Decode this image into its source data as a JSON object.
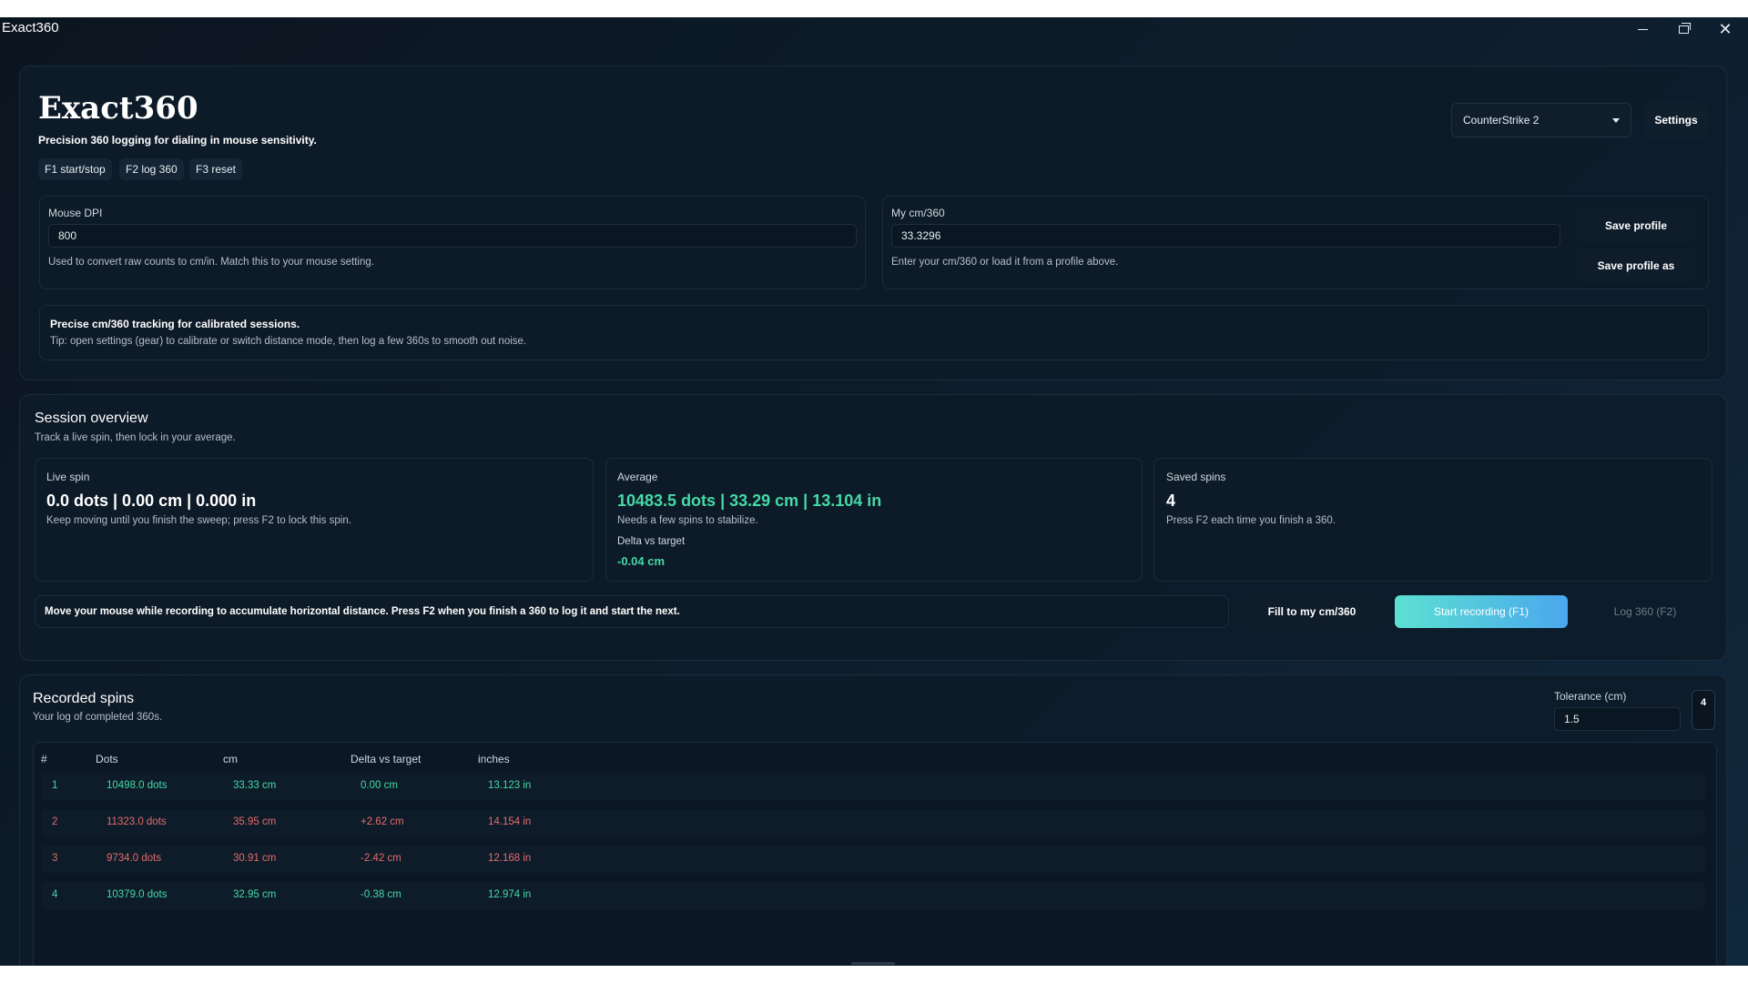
{
  "window": {
    "title": "Exact360",
    "minimize": "—",
    "close": "✕"
  },
  "header": {
    "app_title": "Exact360",
    "subtitle": "Precision 360 logging for dialing in mouse sensitivity.",
    "hotkeys": [
      "F1 start/stop",
      "F2 log 360",
      "F3 reset"
    ],
    "game_select": "CounterStrike 2",
    "settings_label": "Settings"
  },
  "dpi": {
    "label": "Mouse DPI",
    "value": "800",
    "help": "Used to convert raw counts to cm/in. Match this to your mouse setting."
  },
  "cm360": {
    "label": "My cm/360",
    "value": "33.3296",
    "help": "Enter your cm/360 or load it from a profile above."
  },
  "profile": {
    "save_label": "Save profile",
    "save_as_label": "Save profile as"
  },
  "tip": {
    "title": "Precise cm/360 tracking for calibrated sessions.",
    "text": "Tip: open settings (gear) to calibrate or switch distance mode, then log a few 360s to smooth out noise."
  },
  "session": {
    "title": "Session overview",
    "subtitle": "Track a live spin, then lock in your average.",
    "live": {
      "label": "Live spin",
      "value": "0.0 dots | 0.00 cm | 0.000 in",
      "note": "Keep moving until you finish the sweep; press F2 to lock this spin."
    },
    "average": {
      "label": "Average",
      "value": "10483.5 dots | 33.29 cm | 13.104 in",
      "note": "Needs a few spins to stabilize.",
      "delta_label": "Delta vs target",
      "delta_value": "-0.04 cm"
    },
    "saved": {
      "label": "Saved spins",
      "value": "4",
      "note": "Press F2 each time you finish a 360."
    },
    "instruction": "Move your mouse while recording to accumulate horizontal distance. Press F2 when you finish a 360 to log it and start the next.",
    "fill_label": "Fill to my cm/360",
    "start_label": "Start recording (F1)",
    "log_label": "Log 360 (F2)"
  },
  "recorded": {
    "title": "Recorded spins",
    "subtitle": "Your log of completed 360s.",
    "tolerance_label": "Tolerance (cm)",
    "tolerance_value": "1.5",
    "count_badge": "4",
    "columns": [
      "#",
      "Dots",
      "cm",
      "Delta vs target",
      "inches"
    ],
    "rows": [
      {
        "n": "1",
        "dots": "10498.0 dots",
        "cm": "33.33 cm",
        "delta": "0.00 cm",
        "inches": "13.123 in",
        "status": "ok"
      },
      {
        "n": "2",
        "dots": "11323.0 dots",
        "cm": "35.95 cm",
        "delta": "+2.62 cm",
        "inches": "14.154 in",
        "status": "out"
      },
      {
        "n": "3",
        "dots": "9734.0 dots",
        "cm": "30.91 cm",
        "delta": "-2.42 cm",
        "inches": "12.168 in",
        "status": "out"
      },
      {
        "n": "4",
        "dots": "10379.0 dots",
        "cm": "32.95 cm",
        "delta": "-0.38 cm",
        "inches": "12.974 in",
        "status": "ok"
      }
    ]
  },
  "colors": {
    "accent_gradient_start": "#5ce0d2",
    "accent_gradient_end": "#4aa8ec",
    "ok_green": "#46d9a6",
    "out_red": "#e36b6b"
  }
}
